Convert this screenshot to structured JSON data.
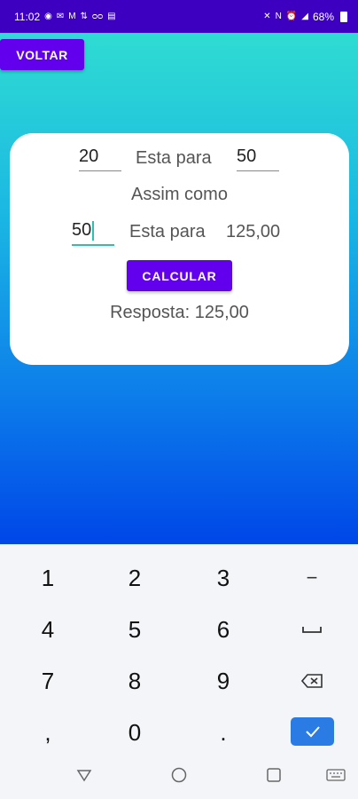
{
  "status_bar": {
    "time": "11:02",
    "left_icons": [
      "whatsapp-icon",
      "mail-icon",
      "gmail-icon",
      "mobile-data-icon",
      "voicemail-icon",
      "news-icon"
    ],
    "right_icons": [
      "mute-icon",
      "nfc-icon",
      "alarm-icon",
      "signal-icon"
    ],
    "battery": "68%"
  },
  "app": {
    "back_button": "VOLTAR",
    "row1": {
      "value_a": "20",
      "label": "Esta para",
      "value_b": "50"
    },
    "middle_label": "Assim como",
    "row2": {
      "value_c": "50",
      "label": "Esta para",
      "result_inline": "125,00"
    },
    "calc_button": "CALCULAR",
    "answer": "Resposta: 125,00"
  },
  "keyboard": {
    "keys": [
      "1",
      "2",
      "3",
      "−",
      "4",
      "5",
      "6",
      "␣",
      "7",
      "8",
      "9",
      "⌫",
      ",",
      "0",
      "."
    ],
    "done_icon": "check-icon"
  },
  "nav_bar": {
    "icons": [
      "back-triangle-icon",
      "home-circle-icon",
      "recents-square-icon",
      "keyboard-icon"
    ]
  },
  "colors": {
    "status_bar": "#3e00c0",
    "button": "#6200ee",
    "gradient_top": "#2fdcd2",
    "gradient_bottom": "#0046e8",
    "accent": "#29c1b0",
    "done_key": "#2a7be4"
  }
}
